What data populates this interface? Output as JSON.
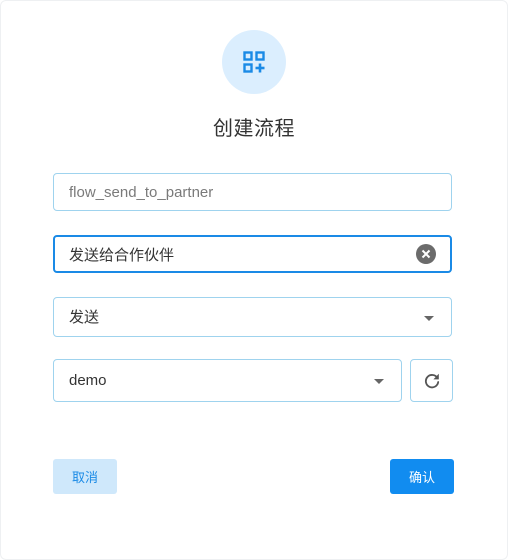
{
  "dialog": {
    "title": "创建流程",
    "header_icon": "apps-add-icon",
    "accent_color": "#118cf0"
  },
  "form": {
    "flow_id": {
      "value": "",
      "placeholder": "flow_send_to_partner"
    },
    "flow_name": {
      "value": "发送给合作伙伴"
    },
    "flow_type": {
      "selected": "发送"
    },
    "environment": {
      "selected": "demo"
    }
  },
  "buttons": {
    "cancel": "取消",
    "confirm": "确认"
  }
}
